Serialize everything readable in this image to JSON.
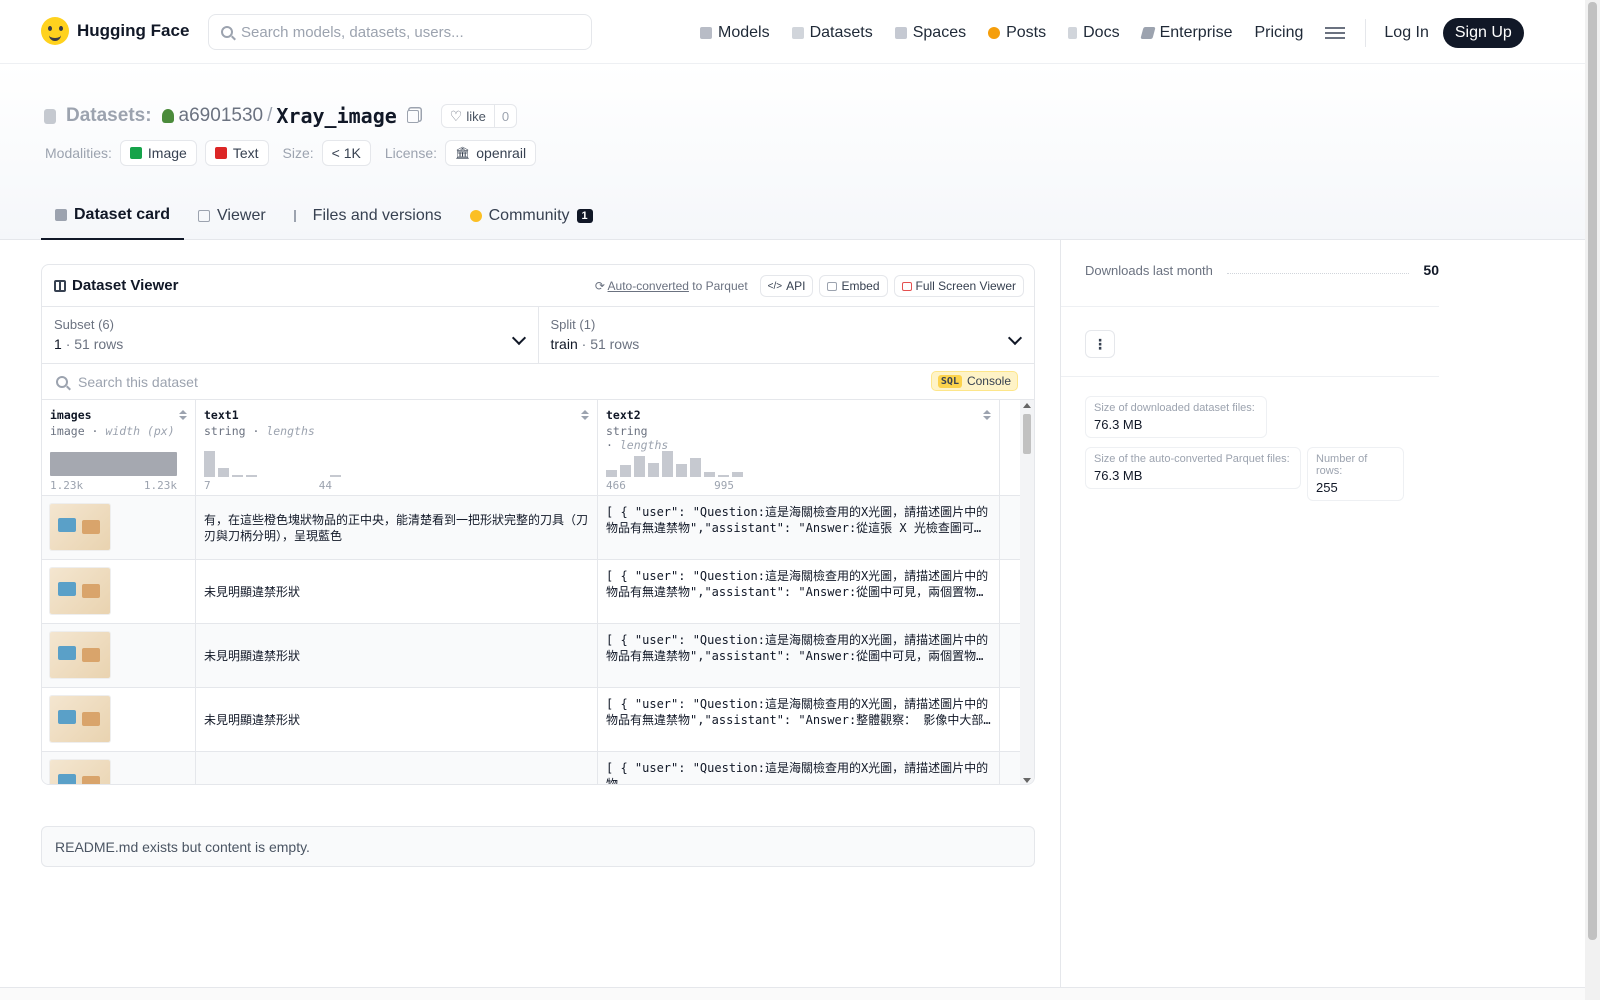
{
  "nav": {
    "brand": "Hugging Face",
    "search_placeholder": "Search models, datasets, users...",
    "links": [
      "Models",
      "Datasets",
      "Spaces",
      "Posts",
      "Docs",
      "Enterprise",
      "Pricing"
    ],
    "login": "Log In",
    "signup": "Sign Up"
  },
  "header": {
    "crumb_label": "Datasets:",
    "owner": "a6901530",
    "separator": "/",
    "name": "Xray_image",
    "like_label": "like",
    "like_count": "0",
    "modalities_label": "Modalities:",
    "modalities": [
      "Image",
      "Text"
    ],
    "size_label": "Size:",
    "size_value": "< 1K",
    "license_label": "License:",
    "license_value": "openrail"
  },
  "tabs": {
    "card": "Dataset card",
    "viewer": "Viewer",
    "files": "Files and versions",
    "community": "Community",
    "community_count": "1"
  },
  "viewer": {
    "title": "Dataset Viewer",
    "auto_converted": "Auto-converted",
    "to_parquet": "to Parquet",
    "api": "API",
    "embed": "Embed",
    "fullscreen": "Full Screen Viewer",
    "subset_label": "Subset (6)",
    "subset_value": "1",
    "subset_rows": "51 rows",
    "split_label": "Split (1)",
    "split_value": "train",
    "split_rows": "51 rows",
    "dot": "·",
    "search_placeholder": "Search this dataset",
    "sql_tag": "SQL",
    "sql_label": "Console",
    "columns": [
      {
        "name": "images",
        "type": "image",
        "stat": "width (px)",
        "min": "1.23k",
        "max": "1.23k"
      },
      {
        "name": "text1",
        "type": "string",
        "stat": "lengths",
        "min": "7",
        "max": "44",
        "bins": [
          1,
          0.35,
          0.08,
          0.05,
          0,
          0,
          0,
          0,
          0,
          0.06
        ]
      },
      {
        "name": "text2",
        "type": "string",
        "stat": "lengths",
        "min": "466",
        "max": "995",
        "bins": [
          0.25,
          0.45,
          0.8,
          0.55,
          1,
          0.5,
          0.72,
          0.18,
          0.08,
          0.2
        ]
      }
    ],
    "rows": [
      {
        "text1": "有，在這些橙色塊狀物品的正中央，能清楚看到一把形狀完整的刀具（刀刃與刀柄分明），呈現藍色",
        "text2": "[ { \"user\": \"Question:這是海關檢查用的X光圖，請描述圖片中的物品有無違禁物\",\"assistant\": \"Answer:從這張 X 光檢查圖可以看到..."
      },
      {
        "text1": "未見明顯違禁形狀",
        "text2": "[ { \"user\": \"Question:這是海關檢查用的X光圖，請描述圖片中的物品有無違禁物\",\"assistant\": \"Answer:從圖中可見，兩個置物箱裡..."
      },
      {
        "text1": "未見明顯違禁形狀",
        "text2": "[ { \"user\": \"Question:這是海關檢查用的X光圖，請描述圖片中的物品有無違禁物\",\"assistant\": \"Answer:從圖中可見，兩個置物箱裡..."
      },
      {
        "text1": "未見明顯違禁形狀",
        "text2": "[ { \"user\": \"Question:這是海關檢查用的X光圖，請描述圖片中的物品有無違禁物\",\"assistant\": \"Answer:整體觀察： 影像中大部分是..."
      },
      {
        "text1": "",
        "text2": "[ { \"user\": \"Question:這是海關檢查用的X光圖，請描述圖片中的物"
      }
    ]
  },
  "readme": "README.md exists but content is empty.",
  "sidebar": {
    "downloads_label": "Downloads last month",
    "downloads_value": "50",
    "more": "⋮",
    "stats": [
      {
        "label": "Size of downloaded dataset files:",
        "value": "76.3 MB"
      },
      {
        "label": "Size of the auto-converted Parquet files:",
        "value": "76.3 MB"
      },
      {
        "label": "Number of rows:",
        "value": "255"
      }
    ]
  },
  "colors": {
    "accent": "#ffd21e",
    "dark": "#111827",
    "border": "#e5e7eb"
  }
}
